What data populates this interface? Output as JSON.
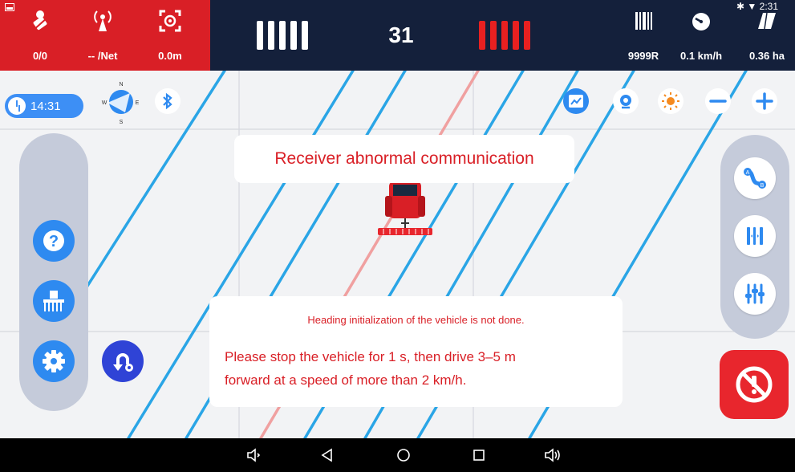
{
  "status_bar": {
    "satellites": "0/0",
    "network": "-- /Net",
    "offset": "0.0m",
    "lane_number": "31",
    "lane_left_bars": 5,
    "lane_right_bars": 5,
    "lane_right_color": "#e82020",
    "rows": "9999R",
    "speed": "0.1 km/h",
    "area": "0.36 ha",
    "android_time": "2:31",
    "red_color": "#d91f26",
    "navy_color": "#14203b"
  },
  "toolbar": {
    "clock_time": "14:31",
    "compass_n": "N",
    "compass_e": "E",
    "compass_s": "S",
    "compass_w": "W"
  },
  "alerts": {
    "receiver_message": "Receiver abnormal communication",
    "heading_title": "Heading initialization of the vehicle is not done.",
    "heading_instruction_line1": "Please stop the vehicle for 1 s, then drive 3–5 m",
    "heading_instruction_line2": "forward at a speed of more than 2 km/h."
  },
  "colors": {
    "accent": "#2e8af0",
    "guidance_line": "#2aa5e6",
    "active_line": "#f0a0a0",
    "alert_text": "#d91f26"
  }
}
